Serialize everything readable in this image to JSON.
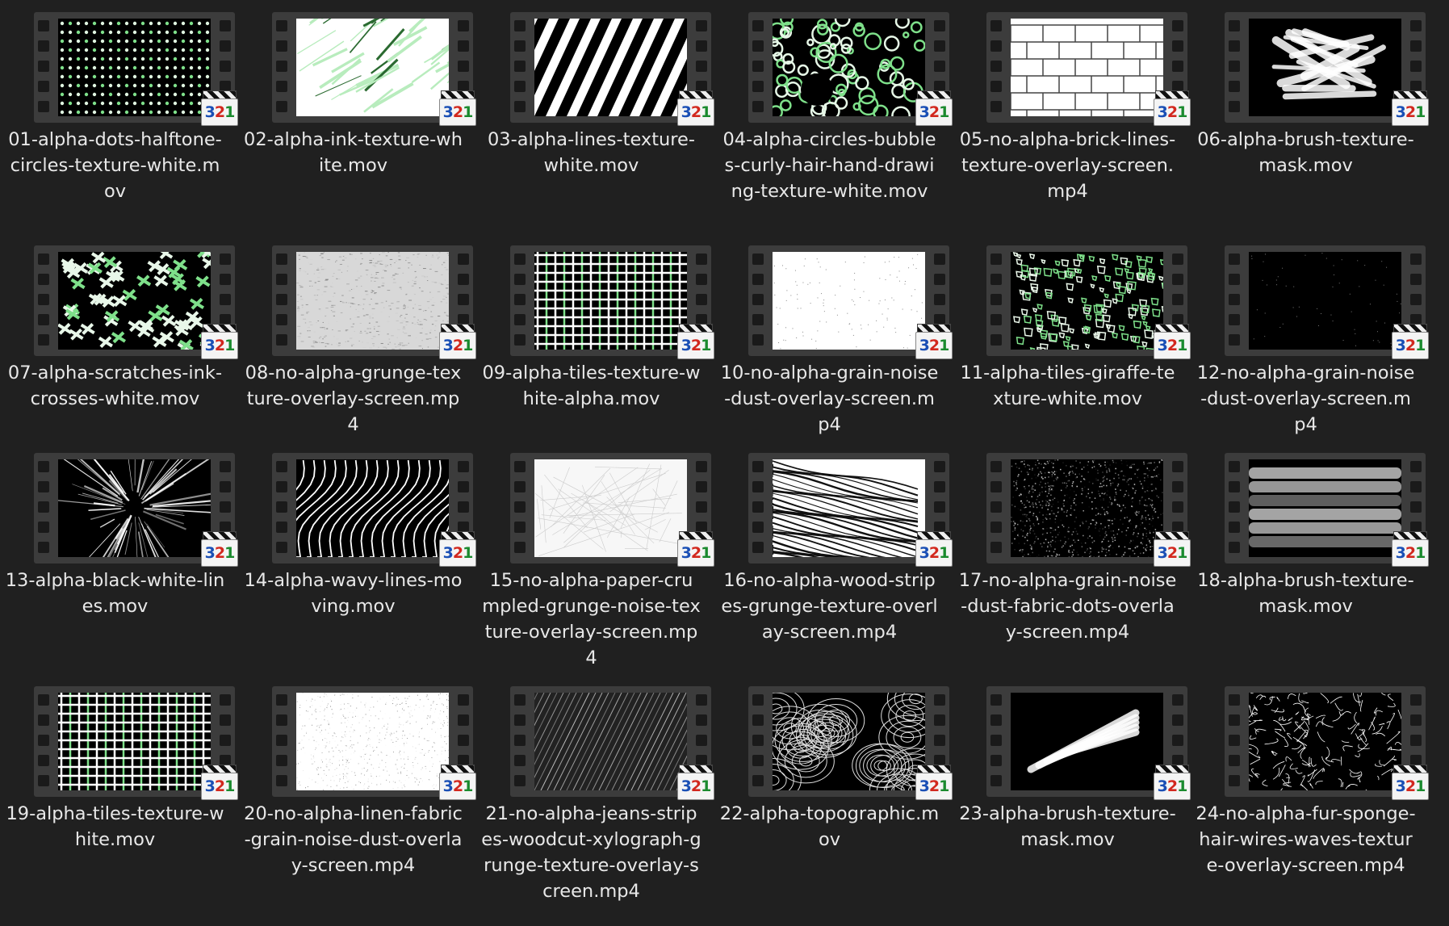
{
  "files": [
    {
      "name": "01-alpha-dots-halftone-circles-texture-white.mov",
      "thumbnail": "white-dots-green-on-black",
      "icon": "media-player-clapperboard-icon"
    },
    {
      "name": "02-alpha-ink-texture-white.mov",
      "thumbnail": "green-ink-streaks-on-white",
      "icon": "media-player-clapperboard-icon"
    },
    {
      "name": "03-alpha-lines-texture-white.mov",
      "thumbnail": "diagonal-black-white-stripes",
      "icon": "media-player-clapperboard-icon"
    },
    {
      "name": "04-alpha-circles-bubbles-curly-hair-hand-drawing-texture-white.mov",
      "thumbnail": "green-bubble-circles",
      "icon": "media-player-clapperboard-icon"
    },
    {
      "name": "05-no-alpha-brick-lines-texture-overlay-screen.mp4",
      "thumbnail": "white-brick-lines",
      "icon": "media-player-clapperboard-icon"
    },
    {
      "name": "06-alpha-brush-texture-mask.mov",
      "thumbnail": "white-brush-scribble-on-black",
      "icon": "media-player-clapperboard-icon"
    },
    {
      "name": "07-alpha-scratches-ink-crosses-white.mov",
      "thumbnail": "green-crosses-on-black",
      "icon": "media-player-clapperboard-icon"
    },
    {
      "name": "08-no-alpha-grunge-texture-overlay-screen.mp4",
      "thumbnail": "grey-grunge",
      "icon": "media-player-clapperboard-icon"
    },
    {
      "name": "09-alpha-tiles-texture-white-alpha.mov",
      "thumbnail": "green-white-grid",
      "icon": "media-player-clapperboard-icon"
    },
    {
      "name": "10-no-alpha-grain-noise-dust-overlay-screen.mp4",
      "thumbnail": "white-grain",
      "icon": "media-player-clapperboard-icon"
    },
    {
      "name": "11-alpha-tiles-giraffe-texture-white.mov",
      "thumbnail": "green-giraffe-tiles",
      "icon": "media-player-clapperboard-icon"
    },
    {
      "name": "12-no-alpha-grain-noise-dust-overlay-screen.mp4",
      "thumbnail": "black-dust",
      "icon": "media-player-clapperboard-icon"
    },
    {
      "name": "13-alpha-black-white-lines.mov",
      "thumbnail": "white-radial-burst-on-black",
      "icon": "media-player-clapperboard-icon"
    },
    {
      "name": "14-alpha-wavy-lines-moving.mov",
      "thumbnail": "white-wavy-lines-on-black",
      "icon": "media-player-clapperboard-icon"
    },
    {
      "name": "15-no-alpha-paper-crumpled-grunge-noise-texture-overlay-screen.mp4",
      "thumbnail": "white-crumpled-paper",
      "icon": "media-player-clapperboard-icon"
    },
    {
      "name": "16-no-alpha-wood-stripes-grunge-texture-overlay-screen.mp4",
      "thumbnail": "wood-grain-lines",
      "icon": "media-player-clapperboard-icon"
    },
    {
      "name": "17-no-alpha-grain-noise-dust-fabric-dots-overlay-screen.mp4",
      "thumbnail": "grey-noise-dots-on-black",
      "icon": "media-player-clapperboard-icon"
    },
    {
      "name": "18-alpha-brush-texture-mask.mov",
      "thumbnail": "grey-brush-strokes",
      "icon": "media-player-clapperboard-icon"
    },
    {
      "name": "19-alpha-tiles-texture-white.mov",
      "thumbnail": "green-white-grid",
      "icon": "media-player-clapperboard-icon"
    },
    {
      "name": "20-no-alpha-linen-fabric-grain-noise-dust-overlay-screen.mp4",
      "thumbnail": "white-linen",
      "icon": "media-player-clapperboard-icon"
    },
    {
      "name": "21-no-alpha-jeans-stripes-woodcut-xylograph-grunge-texture-overlay-screen.mp4",
      "thumbnail": "grey-diagonal-jeans",
      "icon": "media-player-clapperboard-icon"
    },
    {
      "name": "22-alpha-topographic.mov",
      "thumbnail": "white-topographic-lines-on-black",
      "icon": "media-player-clapperboard-icon"
    },
    {
      "name": "23-alpha-brush-texture-mask.mov",
      "thumbnail": "white-brush-strokes-on-black",
      "icon": "media-player-clapperboard-icon"
    },
    {
      "name": "24-no-alpha-fur-sponge-hair-wires-waves-texture-overlay-screen.mp4",
      "thumbnail": "white-fur-wires-on-black",
      "icon": "media-player-clapperboard-icon"
    }
  ],
  "player_icon_digits": [
    "3",
    "2",
    "1"
  ],
  "colors": {
    "background": "#202020",
    "text": "#e8e8e8",
    "film_strip": "#3c3c3c",
    "alpha_green": "#7ee08a"
  }
}
